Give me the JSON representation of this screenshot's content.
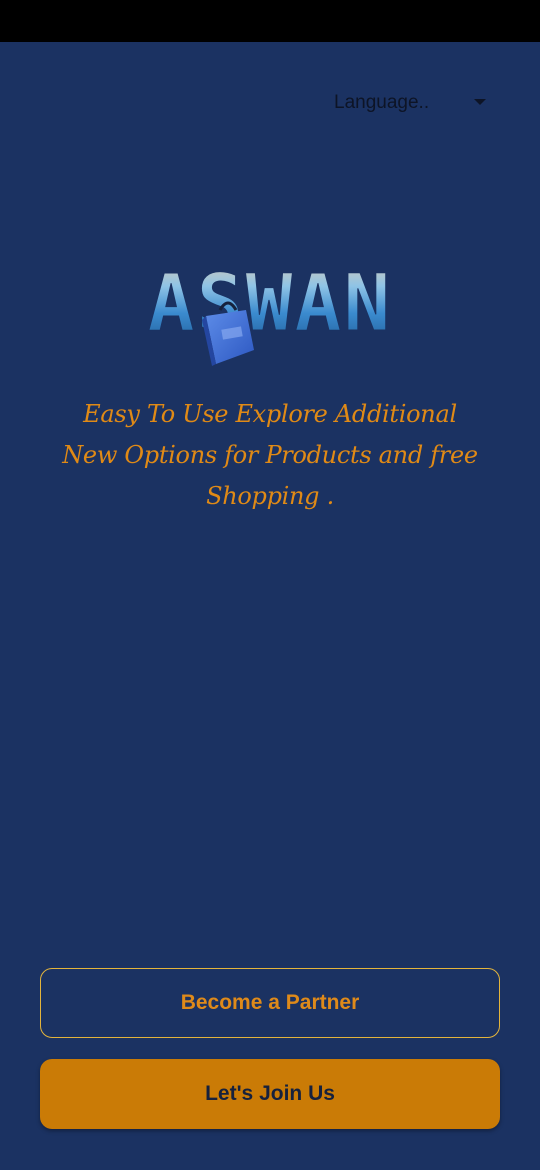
{
  "header": {
    "language_label": "Language.."
  },
  "logo": {
    "text": "ASWAN"
  },
  "main": {
    "tagline_line1": "Easy To Use Explore Additional",
    "tagline_line2": "New Options for Products and free",
    "tagline_line3": "Shopping ."
  },
  "actions": {
    "partner_label": "Become a Partner",
    "join_label": "Let's Join Us"
  },
  "colors": {
    "background": "#1b3262",
    "accent": "#ca7b06",
    "tagline": "#e08a16",
    "partner_border": "#e3b43c"
  },
  "icons": {
    "language_dropdown": "chevron-down-icon",
    "logo_bag": "shopping-bag-icon"
  }
}
